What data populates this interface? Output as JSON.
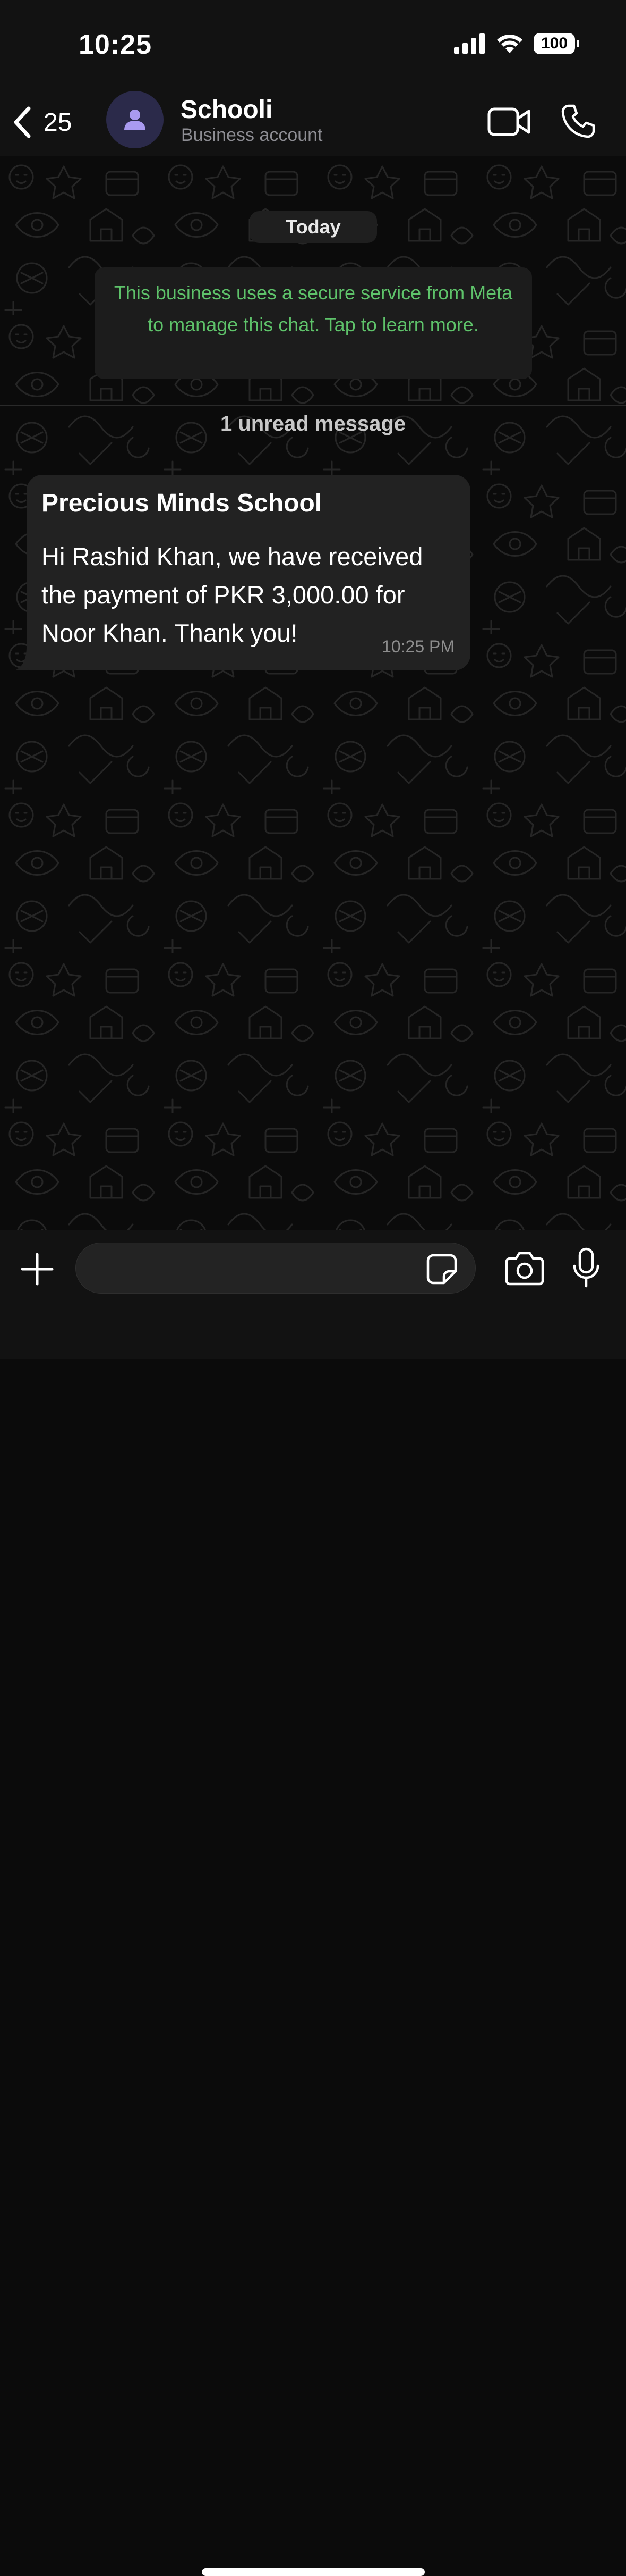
{
  "status_bar": {
    "time": "10:25",
    "battery": "100",
    "icons": [
      "cellular-signal-icon",
      "wifi-icon",
      "battery-icon"
    ]
  },
  "header": {
    "back_count": "25",
    "contact_name": "Schooli",
    "contact_subtitle": "Business account",
    "icons": [
      "back-chevron-icon",
      "person-icon",
      "video-camera-icon",
      "phone-icon"
    ]
  },
  "chat": {
    "date_label": "Today",
    "system_notice": "This business uses a secure service from Meta to manage this chat. Tap to learn more.",
    "unread_label": "1 unread message",
    "messages": [
      {
        "title": "Precious Minds School",
        "body": "Hi Rashid Khan, we have received the payment of PKR 3,000.00 for Noor Khan. Thank you!",
        "time": "10:25 PM"
      }
    ]
  },
  "input_bar": {
    "placeholder": "",
    "icons": [
      "plus-icon",
      "sticker-icon",
      "camera-icon",
      "microphone-icon"
    ]
  },
  "colors": {
    "background": "#0b0b0b",
    "bar": "#121212",
    "bubble": "#222222",
    "notice_text": "#5ec26a",
    "avatar_bg": "#2b2a4a",
    "avatar_icon": "#a99af0"
  }
}
